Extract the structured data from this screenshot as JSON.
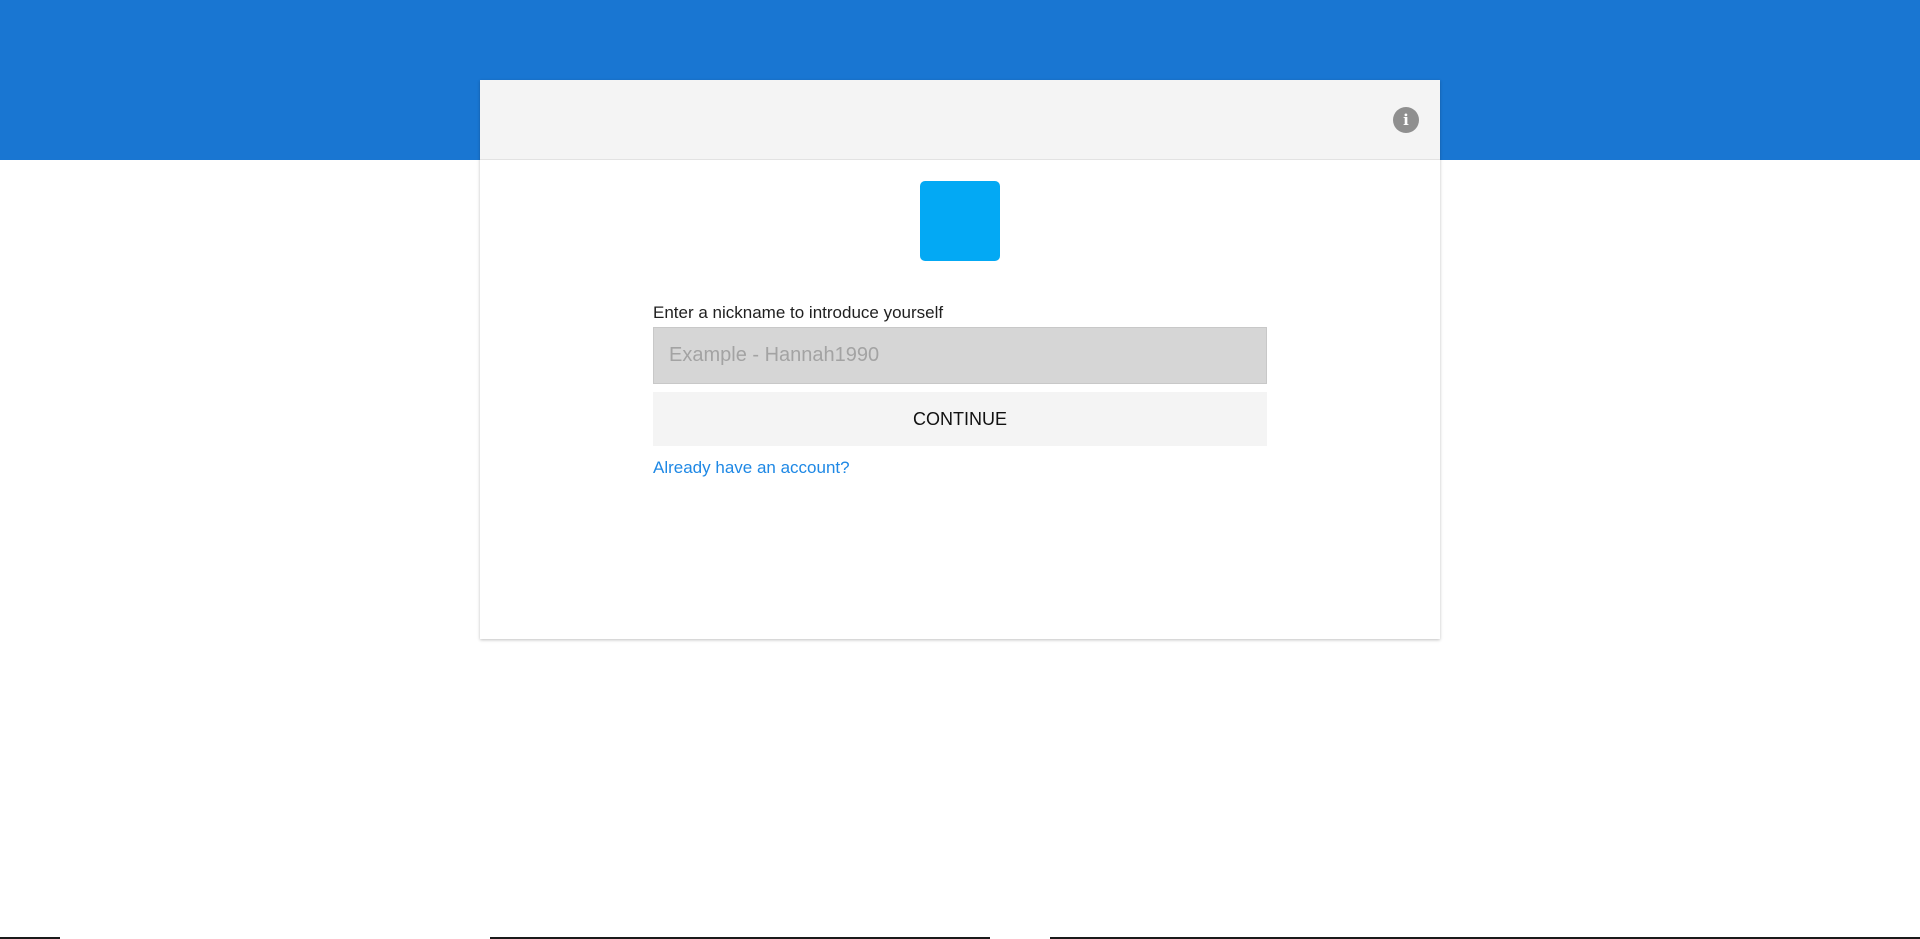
{
  "header": {
    "info_icon": "info-icon"
  },
  "logo": {
    "color": "#03a9f4"
  },
  "form": {
    "label": "Enter a nickname to introduce yourself",
    "nickname": {
      "value": "",
      "placeholder": "Example - Hannah1990"
    },
    "continue_label": "CONTINUE",
    "account_link": "Already have an account?"
  },
  "colors": {
    "banner": "#1976d2",
    "header_bg": "#f4f4f4",
    "link": "#1e88e5",
    "input_bg": "#d6d6d6"
  }
}
